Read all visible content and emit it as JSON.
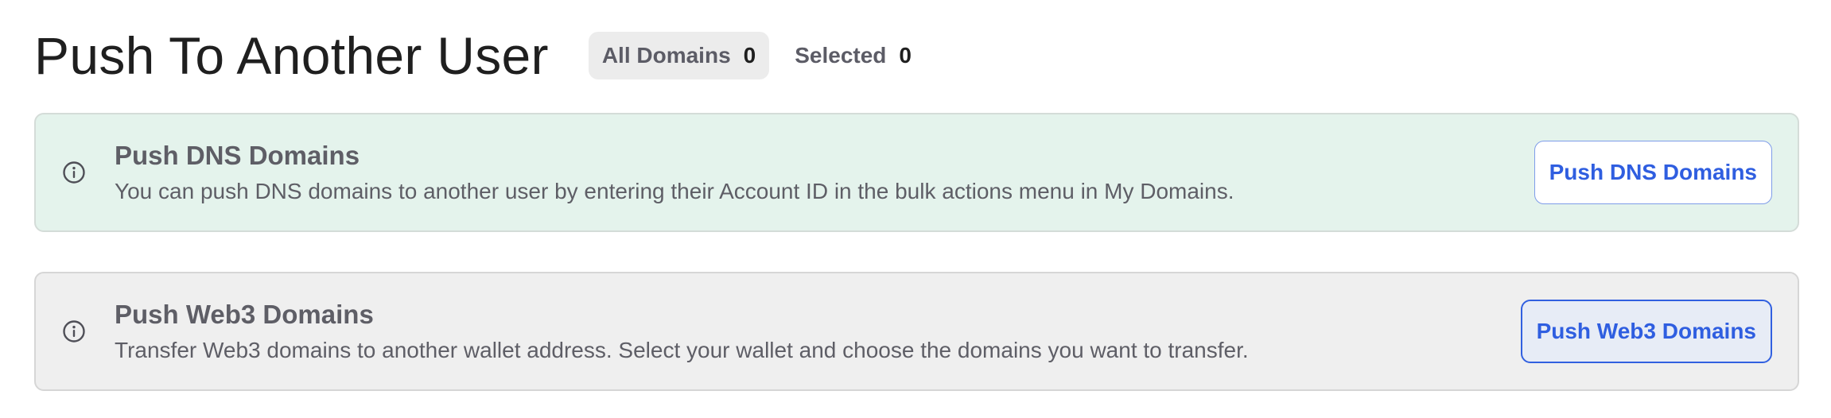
{
  "header": {
    "title": "Push To Another User",
    "tabs": [
      {
        "label": "All Domains",
        "count": "0",
        "active": true
      },
      {
        "label": "Selected",
        "count": "0",
        "active": false
      }
    ]
  },
  "cards": {
    "dns": {
      "icon": "info-icon",
      "title": "Push DNS Domains",
      "description": "You can push DNS domains to another user by entering their Account ID in the bulk actions menu in My Domains.",
      "button_label": "Push DNS Domains"
    },
    "web3": {
      "icon": "info-icon",
      "title": "Push Web3 Domains",
      "description": "Transfer Web3 domains to another wallet address. Select your wallet and choose the domains you want to transfer.",
      "button_label": "Push Web3 Domains"
    }
  },
  "colors": {
    "accent": "#2f5ee0",
    "dns_card_bg": "#e4f3ec",
    "web3_card_bg": "#efefef",
    "active_tab_bg": "#ececec"
  }
}
